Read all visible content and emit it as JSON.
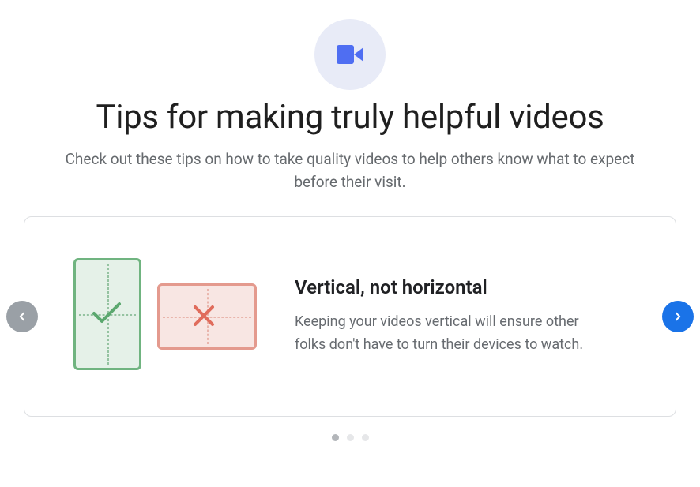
{
  "header": {
    "icon_name": "video-camera-icon",
    "title": "Tips for making truly helpful videos",
    "subtitle": "Check out these tips on how to take quality videos to help others know what to expect before their visit."
  },
  "carousel": {
    "active_index": 0,
    "total": 3,
    "prev_icon": "chevron-left-icon",
    "next_icon": "chevron-right-icon",
    "card": {
      "heading": "Vertical, not horizontal",
      "body": "Keeping your videos vertical will ensure other folks don't have to turn their devices to watch.",
      "illustration": {
        "good": {
          "shape": "portrait-phone",
          "mark": "check",
          "color": "#70b480"
        },
        "bad": {
          "shape": "landscape-phone",
          "mark": "cross",
          "color": "#e06c5c"
        }
      }
    }
  },
  "colors": {
    "icon_circle_bg": "#e8ebf7",
    "accent_blue": "#1a73e8",
    "disabled_gray": "#9aa0a6"
  }
}
